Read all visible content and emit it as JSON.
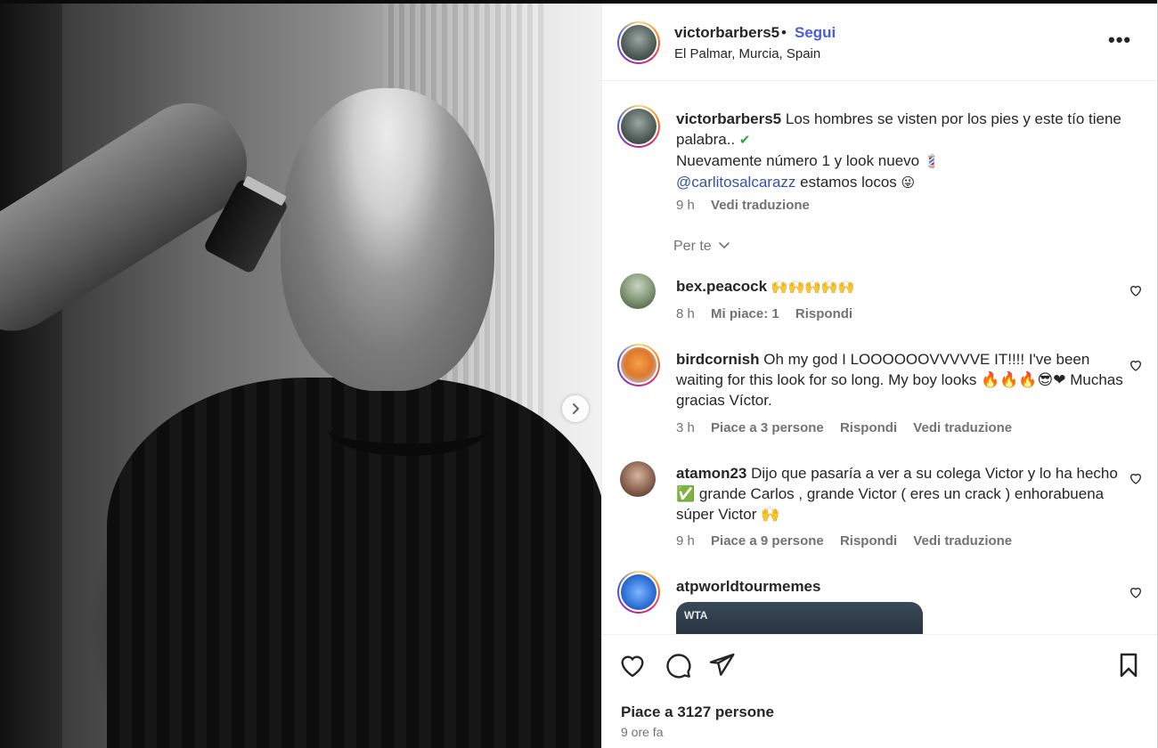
{
  "post": {
    "username": "victorbarbers5",
    "separator": "•",
    "follow_label": "Segui",
    "location": "El Palmar, Murcia, Spain",
    "more_label": "•••"
  },
  "caption": {
    "username": "victorbarbers5",
    "line1": "Los hombres se visten por los pies y este tío tiene palabra..",
    "line1_emoji": "✔",
    "line2": "Nuevamente número 1 y look nuevo",
    "line2_emoji": "💈",
    "mention": "@carlitosalcarazz",
    "line3_rest": "estamos locos",
    "line3_emoji": "😜",
    "time": "9 h",
    "translate": "Vedi traduzione"
  },
  "per_te": "Per te",
  "comments": [
    {
      "username": "bex.peacock",
      "text": "🙌🙌🙌🙌🙌",
      "time": "8 h",
      "likes": "Mi piace: 1",
      "reply": "Rispondi"
    },
    {
      "username": "birdcornish",
      "text": "Oh my god I LOOOOOOVVVVVE IT!!!! I've been waiting for this look for so long. My boy looks 🔥🔥🔥😎❤ Muchas gracias Víctor.",
      "time": "3 h",
      "likes": "Piace a 3 persone",
      "reply": "Rispondi",
      "translate": "Vedi traduzione"
    },
    {
      "username": "atamon23",
      "text": "Dijo que pasaría a ver a su colega Victor y lo ha hecho ✅ grande Carlos , grande Victor ( eres un crack ) enhorabuena súper Victor 🙌",
      "time": "9 h",
      "likes": "Piace a 9 persone",
      "reply": "Rispondi",
      "translate": "Vedi traduzione"
    },
    {
      "username": "atpworldtourmemes",
      "embed_label": "WTA"
    }
  ],
  "actions": {
    "likes": "Piace a 3127 persone",
    "time": "9 ore fa"
  },
  "colors": {
    "follow": "#4a5bdc",
    "mention": "#3552a9",
    "meta": "#737373",
    "text": "#262626"
  }
}
